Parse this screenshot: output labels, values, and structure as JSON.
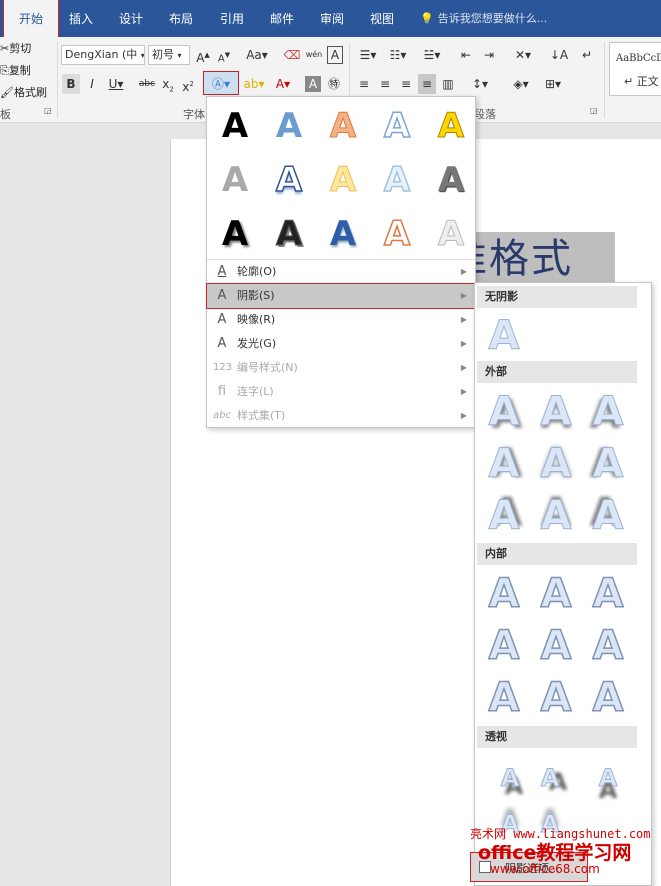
{
  "tabs": [
    "开始",
    "插入",
    "设计",
    "布局",
    "引用",
    "邮件",
    "审阅",
    "视图"
  ],
  "tellme": "告诉我您想要做什么...",
  "clipboard": {
    "cut": "剪切",
    "copy": "复制",
    "format": "格式刷",
    "group": "板"
  },
  "font": {
    "name": "DengXian (中",
    "size": "初号",
    "group": "字体"
  },
  "styles": {
    "preview": "AaBbCcD",
    "normal": "↵ 正文"
  },
  "para_group": "段落",
  "doc": {
    "title_fragment": "准格式"
  },
  "menu": {
    "items": [
      {
        "label": "轮廓(O)"
      },
      {
        "label": "阴影(S)"
      },
      {
        "label": "映像(R)"
      },
      {
        "label": "发光(G)"
      },
      {
        "label": "编号样式(N)"
      },
      {
        "label": "连字(L)"
      },
      {
        "label": "样式集(T)"
      }
    ]
  },
  "submenu": {
    "no_shadow": "无阴影",
    "outer": "外部",
    "inner": "内部",
    "perspective": "透视",
    "option": "阴影选项..."
  },
  "watermark": {
    "line1": "亮术网 www.liangshunet.com",
    "line2": "office教程学习网",
    "line3": "www.office68.com"
  }
}
